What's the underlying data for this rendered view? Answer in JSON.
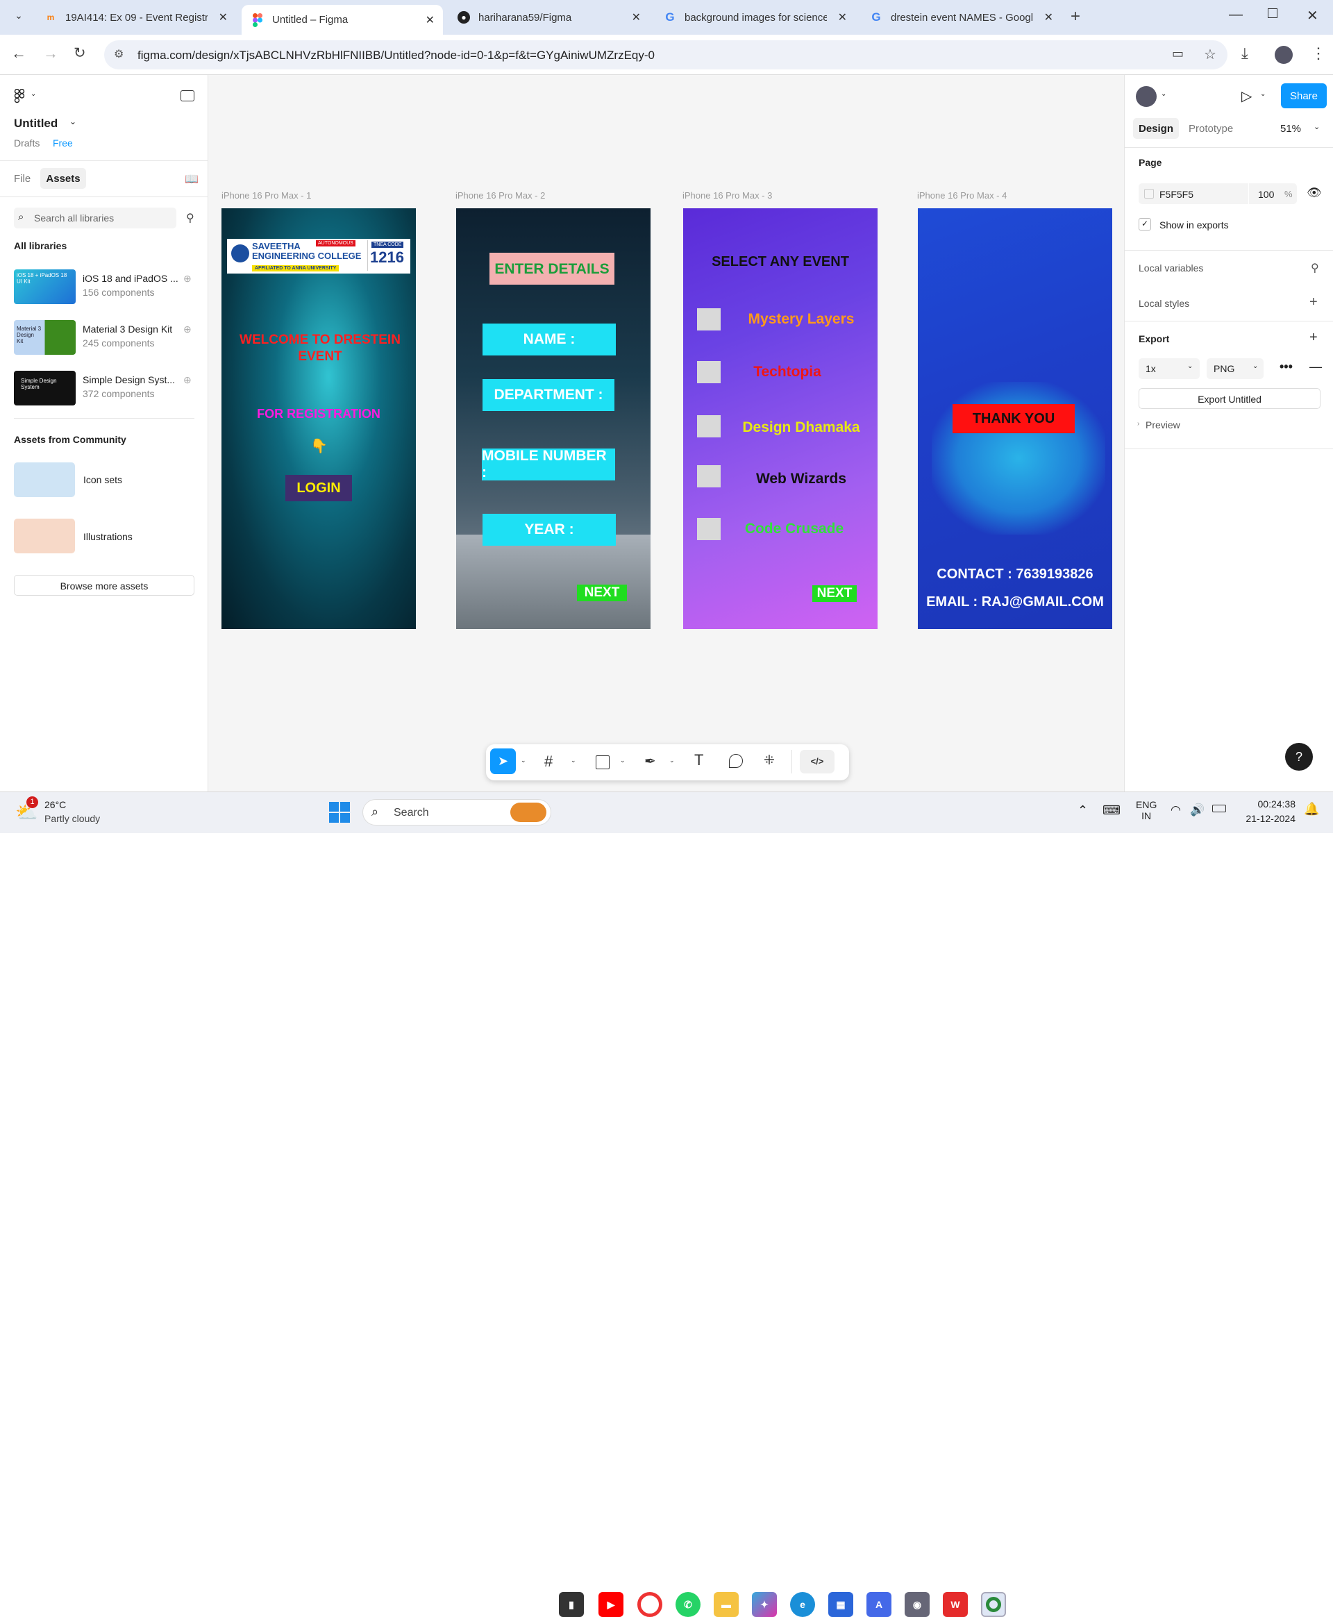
{
  "browser": {
    "tabs": [
      {
        "title": "19AI414: Ex 09 - Event Registrat",
        "icon": "moodle-icon"
      },
      {
        "title": "Untitled – Figma",
        "icon": "figma-icon"
      },
      {
        "title": "hariharana59/Figma",
        "icon": "github-icon"
      },
      {
        "title": "background images for science",
        "icon": "google-icon"
      },
      {
        "title": "drestein event NAMES - Google",
        "icon": "google-icon"
      }
    ],
    "url": "figma.com/design/xTjsABCLNHVzRbHlFNIIBB/Untitled?node-id=0-1&p=f&t=GYgAiniwUMZrzEqy-0"
  },
  "left_panel": {
    "file_name": "Untitled",
    "drafts": "Drafts",
    "plan": "Free",
    "tabs": [
      "File",
      "Assets"
    ],
    "search_placeholder": "Search all libraries",
    "all_libraries": "All libraries",
    "libraries": [
      {
        "name": "iOS 18 and iPadOS ...",
        "count": "156 components",
        "thumb": "iOS 18 + iPadOS 18 UI Kit"
      },
      {
        "name": "Material 3 Design Kit",
        "count": "245 components",
        "thumb": "Material 3 Design Kit"
      },
      {
        "name": "Simple Design Syst...",
        "count": "372 components",
        "thumb": "Simple Design System"
      }
    ],
    "community_heading": "Assets from Community",
    "community": [
      "Icon sets",
      "Illustrations"
    ],
    "browse_button": "Browse more assets"
  },
  "canvas": {
    "frames": [
      {
        "label": "iPhone 16 Pro Max - 1",
        "college_name": "SAVEETHA ENGINEERING COLLEGE",
        "college_tag": "AUTONOMOUS",
        "college_affil": "AFFILIATED TO ANNA UNIVERSITY",
        "tnea_label": "TNEA CODE",
        "tnea_code": "1216",
        "welcome": "WELCOME TO DRESTEIN EVENT",
        "for_reg": "FOR REGISTRATION",
        "pointer": "👇",
        "login": "LOGIN"
      },
      {
        "label": "iPhone 16 Pro Max - 2",
        "heading": "ENTER DETAILS",
        "fields": [
          "NAME :",
          "DEPARTMENT :",
          "MOBILE NUMBER :",
          "YEAR :"
        ],
        "next": "NEXT"
      },
      {
        "label": "iPhone 16 Pro Max - 3",
        "heading": "SELECT  ANY EVENT",
        "events": [
          "Mystery Layers",
          "Techtopia",
          "Design Dhamaka",
          "Web Wizards",
          "Code Crusade"
        ],
        "next": "NEXT"
      },
      {
        "label": "iPhone 16 Pro Max - 4",
        "thank_you": "THANK YOU",
        "contact": "CONTACT : 7639193826",
        "email": "EMAIL : RAJ@GMAIL.COM"
      }
    ]
  },
  "right_panel": {
    "share": "Share",
    "tabs": [
      "Design",
      "Prototype"
    ],
    "zoom": "51%",
    "page_heading": "Page",
    "page_color": "F5F5F5",
    "page_opacity": "100",
    "percent": "%",
    "show_in_exports": "Show in exports",
    "local_variables": "Local variables",
    "local_styles": "Local styles",
    "export_heading": "Export",
    "export_scale": "1x",
    "export_format": "PNG",
    "export_button": "Export Untitled",
    "preview": "Preview",
    "help": "?"
  },
  "taskbar": {
    "weather_temp": "26°C",
    "weather_desc": "Partly cloudy",
    "weather_badge": "1",
    "search": "Search",
    "lang1": "ENG",
    "lang2": "IN",
    "time": "00:24:38",
    "date": "21-12-2024"
  },
  "colors": {
    "accent": "#0d99ff",
    "canvas_bg": "#f5f5f5",
    "cyan_box": "#1ee0f4",
    "next_green": "#22dd22",
    "thank_you_red": "#ff1010"
  }
}
